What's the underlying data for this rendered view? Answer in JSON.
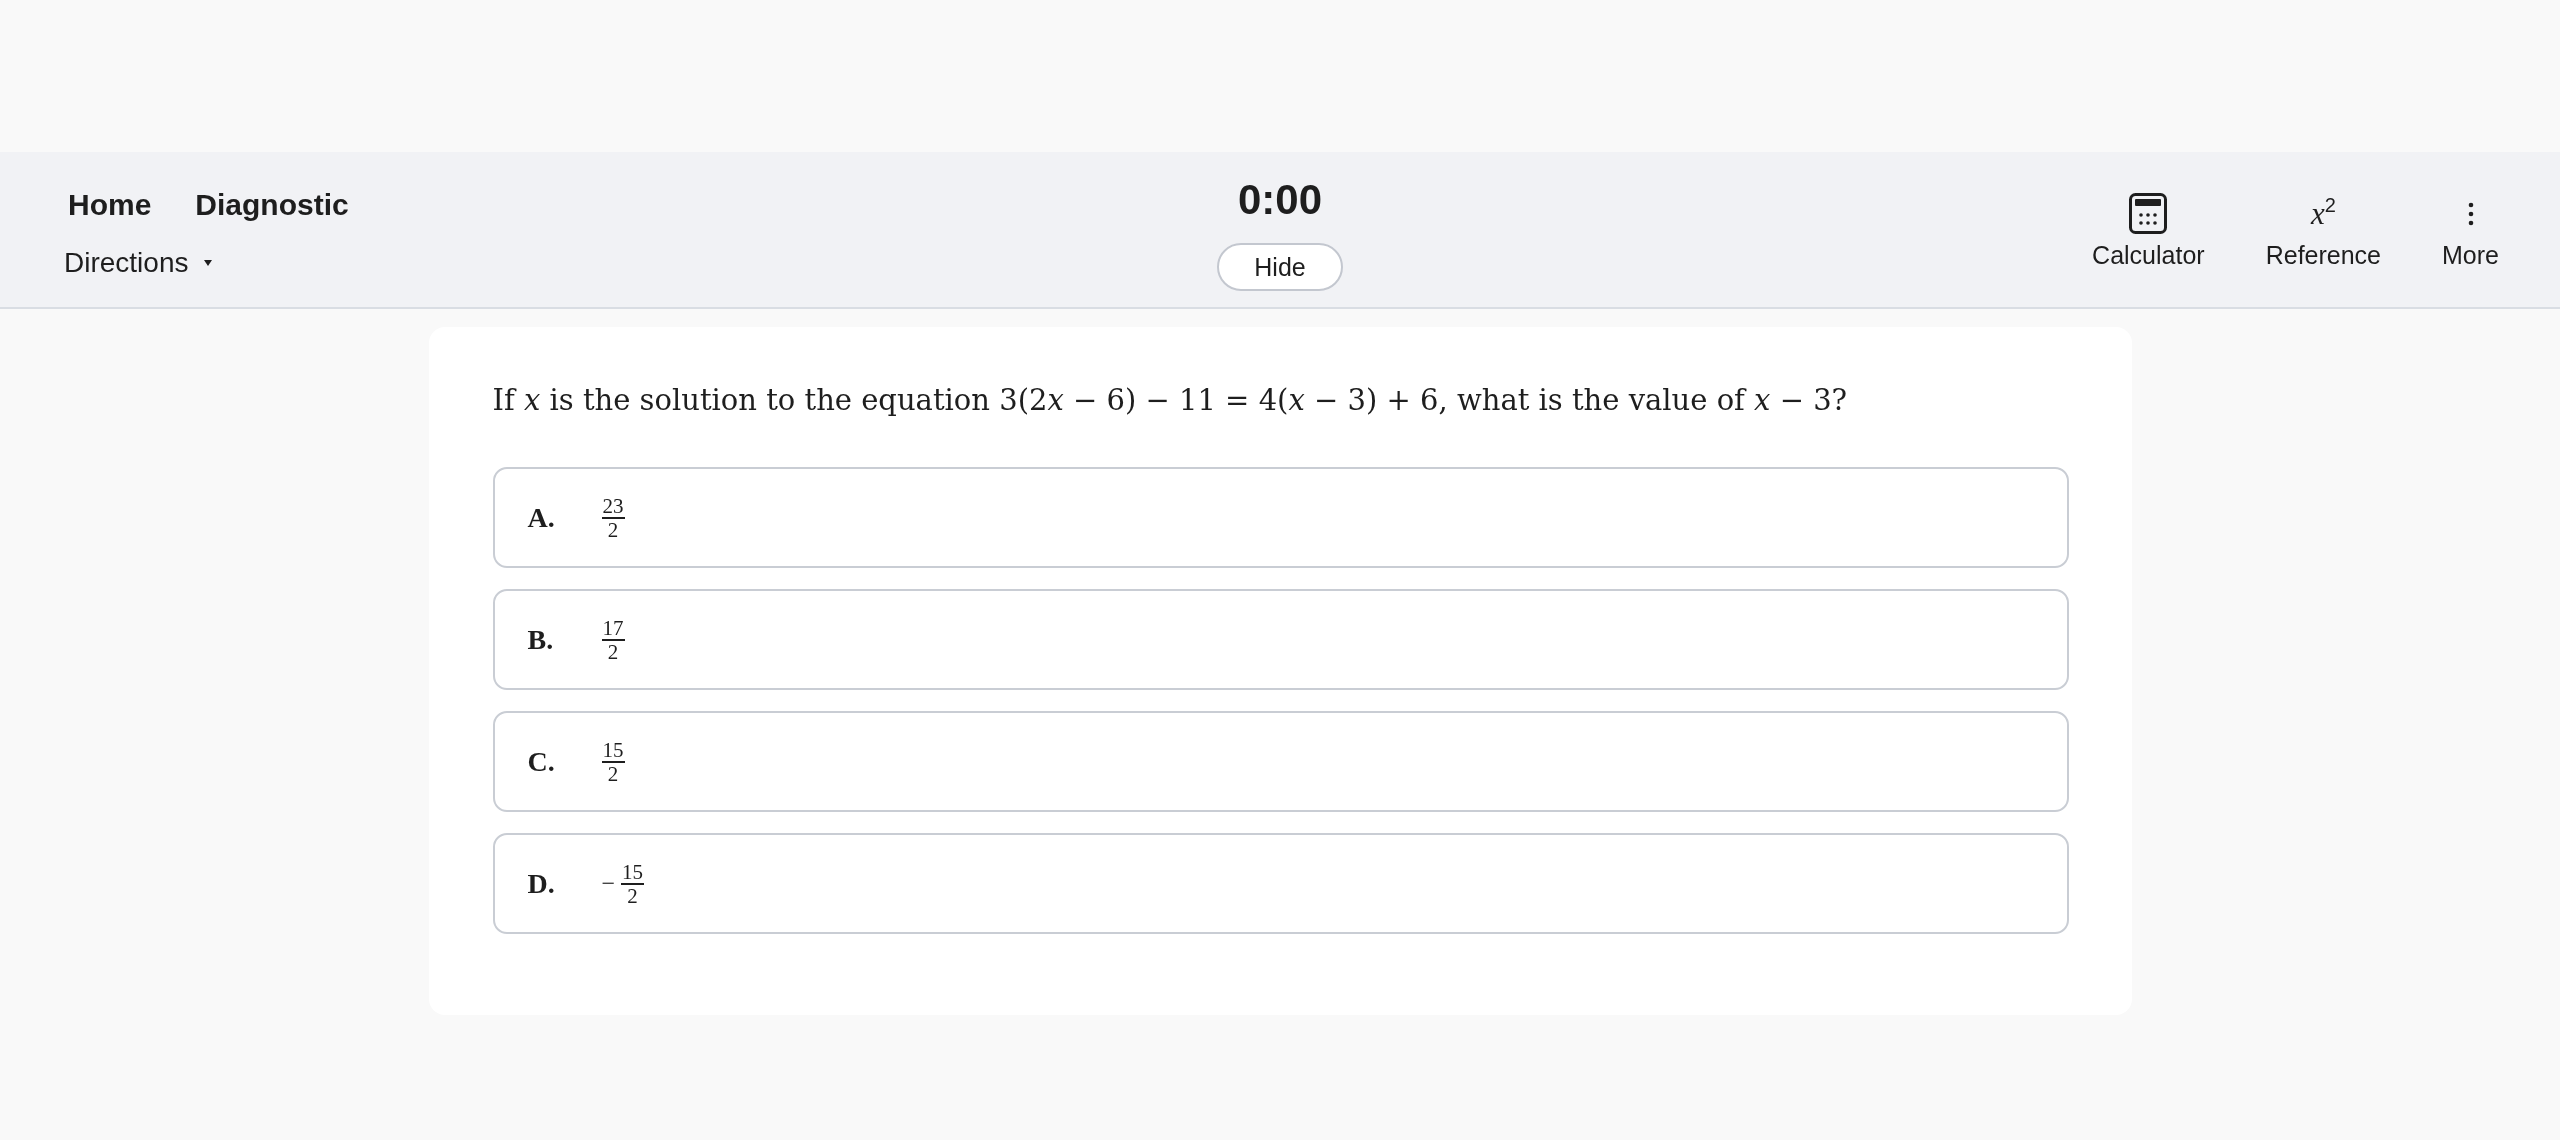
{
  "header": {
    "home": "Home",
    "title": "Diagnostic",
    "directions": "Directions"
  },
  "timer": {
    "time": "0:00",
    "hide": "Hide"
  },
  "tools": [
    {
      "kind": "calculator",
      "label": "Calculator"
    },
    {
      "kind": "reference",
      "symbol": "*x*$^{2}$",
      "label": "Reference"
    },
    {
      "kind": "more",
      "label": "More"
    }
  ],
  "question": {
    "segments": [
      {
        "kind": "text",
        "text": "If "
      },
      {
        "kind": "variable",
        "text": "x"
      },
      {
        "kind": "text",
        "text": " is the solution to the equation 3(2"
      },
      {
        "kind": "variable",
        "text": "x"
      },
      {
        "kind": "text",
        "text": " − 6) − 11 = 4("
      },
      {
        "kind": "variable",
        "text": "x"
      },
      {
        "kind": "text",
        "text": " − 3) + 6, what is the value of "
      },
      {
        "kind": "variable",
        "text": "x"
      },
      {
        "kind": "text",
        "text": " − 3?"
      }
    ]
  },
  "options": [
    {
      "letter": "A.",
      "numerator": "23",
      "denominator": "2",
      "selected": false
    },
    {
      "letter": "B.",
      "numerator": "17",
      "denominator": "2",
      "selected": false
    },
    {
      "letter": "C.",
      "numerator": "15",
      "denominator": "2",
      "selected": false
    },
    {
      "letter": "D.",
      "sign": "−",
      "numerator": "15",
      "denominator": "2",
      "selected": false
    }
  ]
}
